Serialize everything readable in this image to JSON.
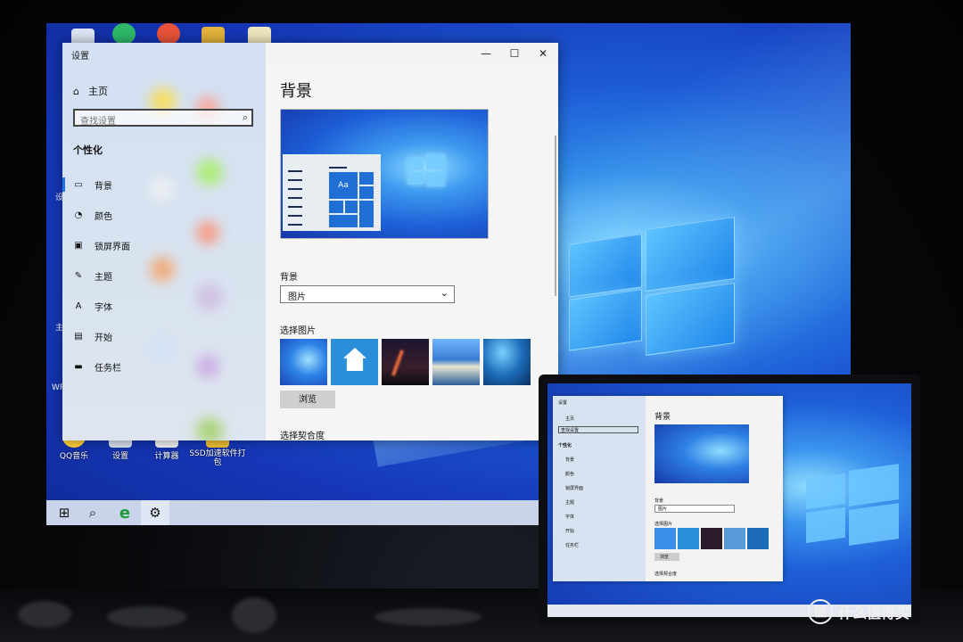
{
  "settings": {
    "window_title": "设置",
    "controls": {
      "minimize": "—",
      "maximize": "☐",
      "close": "✕"
    },
    "home_label": "主页",
    "search_placeholder": "查找设置",
    "section_label": "个性化",
    "nav_items": [
      {
        "label": "背景",
        "icon": "picture-icon"
      },
      {
        "label": "颜色",
        "icon": "palette-icon"
      },
      {
        "label": "锁屏界面",
        "icon": "lock-screen-icon"
      },
      {
        "label": "主题",
        "icon": "theme-icon"
      },
      {
        "label": "字体",
        "icon": "font-icon"
      },
      {
        "label": "开始",
        "icon": "start-icon"
      },
      {
        "label": "任务栏",
        "icon": "taskbar-icon"
      }
    ],
    "page_title": "背景",
    "preview_tile_text": "Aa",
    "background_label": "背景",
    "background_value": "图片",
    "choose_picture_label": "选择图片",
    "browse_label": "浏览",
    "fit_label": "选择契合度"
  },
  "desktop": {
    "icons": [
      {
        "label": "QQ音乐"
      },
      {
        "label": "设置"
      },
      {
        "label": "计算器"
      },
      {
        "label": "SSD加速软件打包"
      }
    ],
    "edge_fragments": [
      "设",
      "主",
      "WP"
    ]
  },
  "taskbar": {
    "buttons": [
      {
        "name": "start-button",
        "glyph": "⊞"
      },
      {
        "name": "search-button",
        "glyph": "⌕"
      },
      {
        "name": "ie-button",
        "glyph": "e"
      },
      {
        "name": "settings-button",
        "glyph": "⚙"
      }
    ]
  },
  "laptop": {
    "settings_title": "设置",
    "home_label": "主页",
    "search_placeholder": "查找设置",
    "section_label": "个性化",
    "nav_items": [
      "背景",
      "颜色",
      "锁屏界面",
      "主题",
      "字体",
      "开始",
      "任务栏"
    ],
    "page_title": "背景",
    "background_label": "背景",
    "background_value": "图片",
    "choose_picture_label": "选择图片",
    "browse_label": "浏览",
    "fit_label": "选择契合度"
  },
  "watermark": {
    "logo_glyph": "值",
    "text": "什么值得买"
  },
  "colors": {
    "accent": "#1a73e8",
    "desktop_blue": "#1d5bd6",
    "taskbar": "#c9d4ea"
  }
}
